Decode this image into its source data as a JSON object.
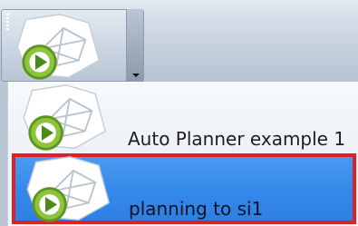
{
  "app": {
    "window": "Planner quick-access"
  },
  "main_button": {
    "icon": "play-planner-icon"
  },
  "dropdown": {
    "items": [
      {
        "label": "Auto Planner example 1",
        "icon": "play-planner-icon",
        "selected": false
      },
      {
        "label": "planning to si1",
        "icon": "play-planner-icon",
        "selected": true
      }
    ]
  },
  "colors": {
    "selection": "#3488ea",
    "highlight_border": "#e02027",
    "play_badge": "#8cc43c"
  }
}
